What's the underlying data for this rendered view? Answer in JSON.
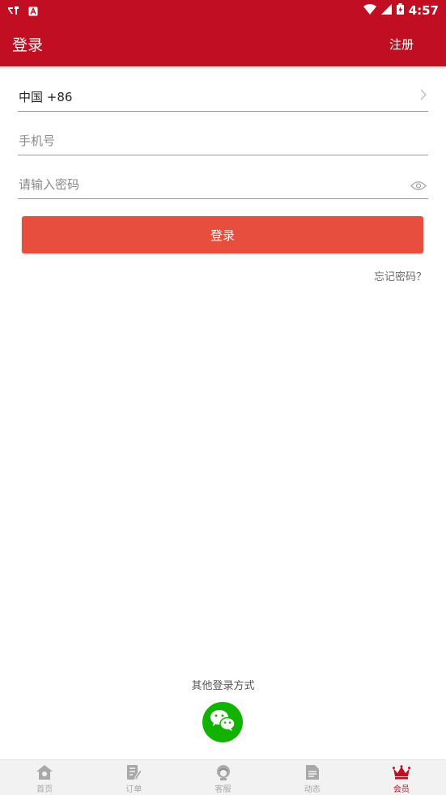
{
  "status_bar": {
    "time": "4:57"
  },
  "app_bar": {
    "title": "登录",
    "register": "注册"
  },
  "form": {
    "country_code": "中国 +86",
    "phone_placeholder": "手机号",
    "password_placeholder": "请输入密码",
    "login_button": "登录",
    "forgot_password": "忘记密码？"
  },
  "other_login": {
    "label": "其他登录方式",
    "icon": "wechat-icon"
  },
  "tabs": [
    {
      "label": "首页",
      "icon": "home-icon"
    },
    {
      "label": "订单",
      "icon": "order-icon"
    },
    {
      "label": "客服",
      "icon": "customer-service-icon"
    },
    {
      "label": "动态",
      "icon": "news-icon"
    },
    {
      "label": "会员",
      "icon": "crown-icon"
    }
  ],
  "active_tab": "会员",
  "colors": {
    "brand": "#c20e22",
    "button": "#e84e3d",
    "wechat": "#12b300",
    "inactive": "#a8a8a8"
  }
}
